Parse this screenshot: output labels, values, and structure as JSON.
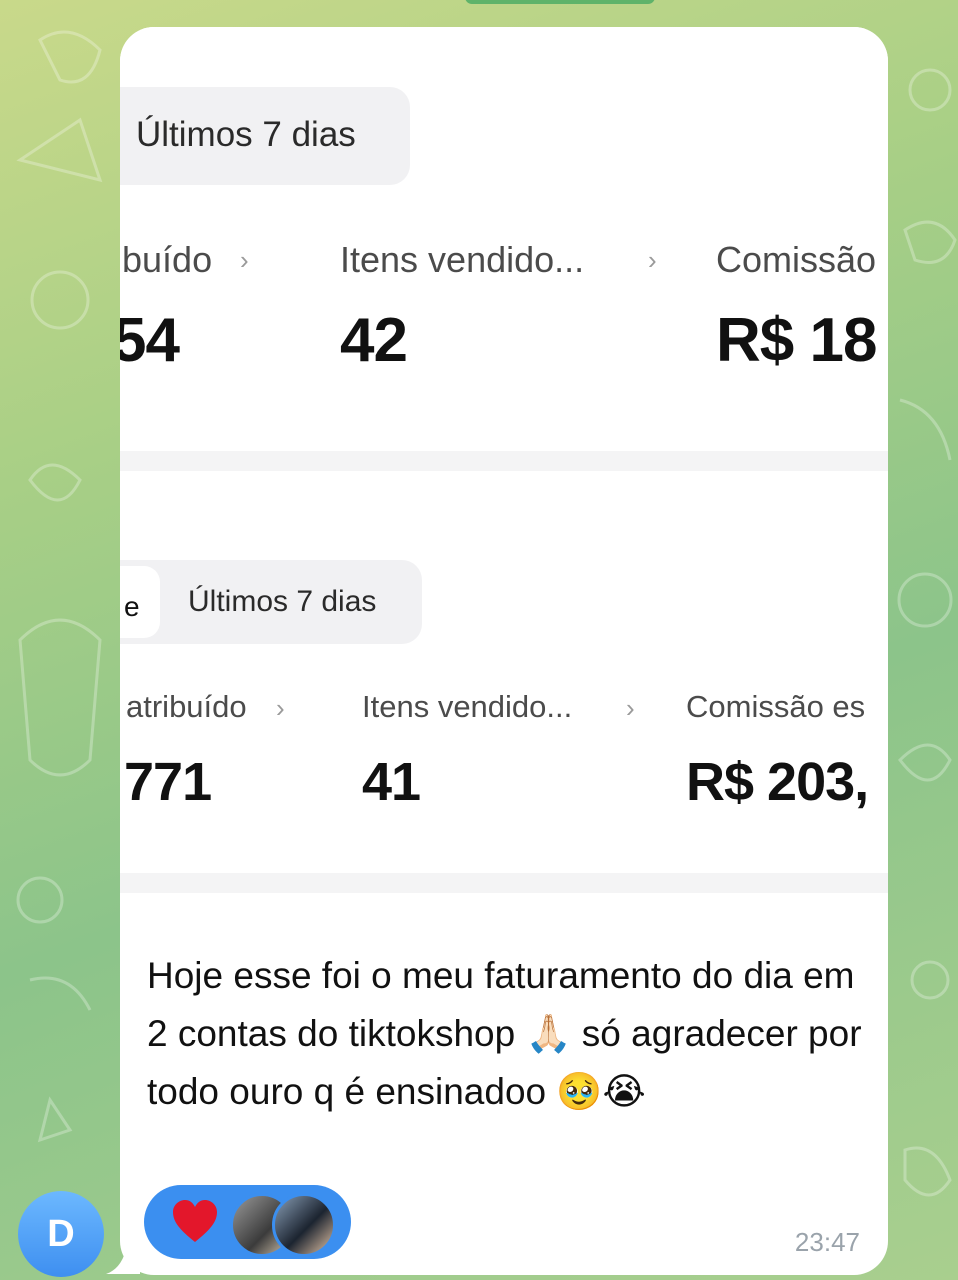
{
  "screenshot": {
    "section1": {
      "period_filter": "Últimos 7 dias",
      "metrics": [
        {
          "label": "buído",
          "value": "54"
        },
        {
          "label": "Itens vendido...",
          "value": "42"
        },
        {
          "label": "Comissão",
          "value": "R$ 18"
        }
      ]
    },
    "section2": {
      "active_segment": "e",
      "period_filter": "Últimos 7 dias",
      "metrics": [
        {
          "label": "atribuído",
          "value": "771"
        },
        {
          "label": "Itens vendido...",
          "value": "41"
        },
        {
          "label": "Comissão es",
          "value": "R$ 203,"
        }
      ]
    },
    "chevron": "›"
  },
  "message": {
    "text": "Hoje esse foi o meu faturamento do dia em 2 contas do tiktokshop 🙏🏻 só agradecer por todo ouro q é ensinadoo 🥹😭",
    "time": "23:47"
  },
  "reaction": {
    "emoji": "heart-icon"
  },
  "sender": {
    "initial": "D"
  },
  "colors": {
    "bubble": "#ffffff",
    "reaction_pill": "#3b8ff0",
    "avatar": "#4a97f2",
    "heart": "#e3172b"
  }
}
